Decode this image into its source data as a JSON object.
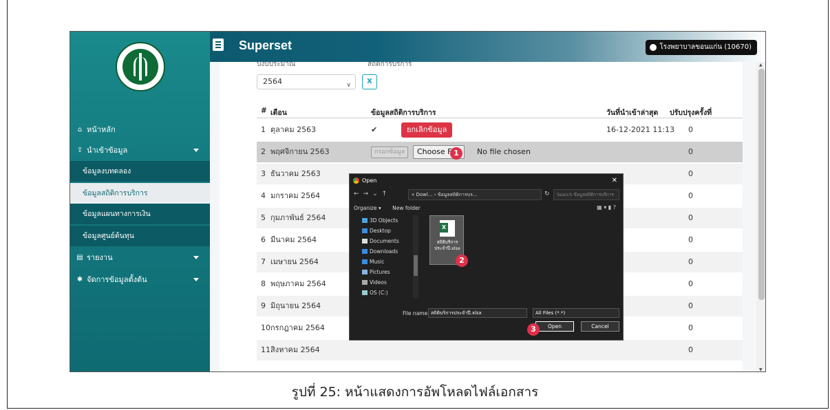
{
  "app": {
    "brand": "Superset",
    "user_badge": "โรงพยาบาลขอนแก่น (10670)"
  },
  "sidebar": {
    "logo_alt": "กระทรวงสาธารณสุข MINISTRY OF PUBLIC HEALTH",
    "items": [
      {
        "label": "หน้าหลัก",
        "icon": "home-icon"
      },
      {
        "label": "นำเข้าข้อมูล",
        "icon": "upload-icon"
      },
      {
        "label": "รายงาน",
        "icon": "document-icon"
      },
      {
        "label": "จัดการข้อมูลตั้งต้น",
        "icon": "gear-icon"
      }
    ],
    "sub_items": [
      {
        "label": "ข้อมูลงบทดลอง"
      },
      {
        "label": "ข้อมูลสถิติการบริการ"
      },
      {
        "label": "ข้อมูลแผนทางการเงิน"
      },
      {
        "label": "ข้อมูลศูนย์ต้นทุน"
      }
    ]
  },
  "filters": {
    "year_label": "ปีงบประมาณ",
    "type_label": "สถิติการบริการ",
    "year_value": "2564"
  },
  "table": {
    "headers": [
      "#",
      "เดือน",
      "ข้อมูลสถิติการบริการ",
      "วันที่นำเข้าล่าสุด",
      "ปรับปรุงครั้งที่"
    ],
    "rows": [
      {
        "num": "1",
        "month": "ตุลาคม 2563",
        "imported": "16-12-2021 11:13",
        "update": "0",
        "cancel": "ยกเลิกข้อมูล"
      },
      {
        "num": "2",
        "month": "พฤศจิกายน 2563",
        "update": "0",
        "fill": "กรอกข้อมูล",
        "choose": "Choose File",
        "no_file": "No file chosen"
      },
      {
        "num": "3",
        "month": "ธันวาคม 2563",
        "update": "0"
      },
      {
        "num": "4",
        "month": "มกราคม 2564",
        "update": "0"
      },
      {
        "num": "5",
        "month": "กุมภาพันธ์ 2564",
        "update": "0"
      },
      {
        "num": "6",
        "month": "มีนาคม 2564",
        "update": "0"
      },
      {
        "num": "7",
        "month": "เมษายน 2564",
        "update": "0"
      },
      {
        "num": "8",
        "month": "พฤษภาคม 2564",
        "update": "0"
      },
      {
        "num": "9",
        "month": "มิถุนายน 2564",
        "update": "0"
      },
      {
        "num": "10",
        "month": "กรกฎาคม 2564",
        "update": "0"
      },
      {
        "num": "11",
        "month": "สิงหาคม 2564",
        "update": "0"
      }
    ]
  },
  "dialog": {
    "title": "Open",
    "address": "« Dowl... › ข้อมูลสถิติการบร...",
    "search_placeholder": "Search ข้อมูลสถิติการบริการ",
    "organize": "Organize ▾",
    "new_folder": "New folder",
    "tree": [
      "3D Objects",
      "Desktop",
      "Documents",
      "Downloads",
      "Music",
      "Pictures",
      "Videos",
      "OS (C:)"
    ],
    "file_tile_name": "สถิติบริการประจำปี.xlsx",
    "file_name_label": "File name:",
    "file_name_value": "สถิติบริการประจำปี.xlsx",
    "filter_value": "All Files (*.*)",
    "open_label": "Open",
    "cancel_label": "Cancel"
  },
  "steps": [
    "1",
    "2",
    "3"
  ],
  "caption": "รูปที่ 25: หน้าแสดงการอัพโหลดไฟล์เอกสาร",
  "colors": {
    "sidebar": "#147b80",
    "danger": "#dc3545",
    "step_marker": "#e0304a",
    "excel": "#1f7244"
  }
}
